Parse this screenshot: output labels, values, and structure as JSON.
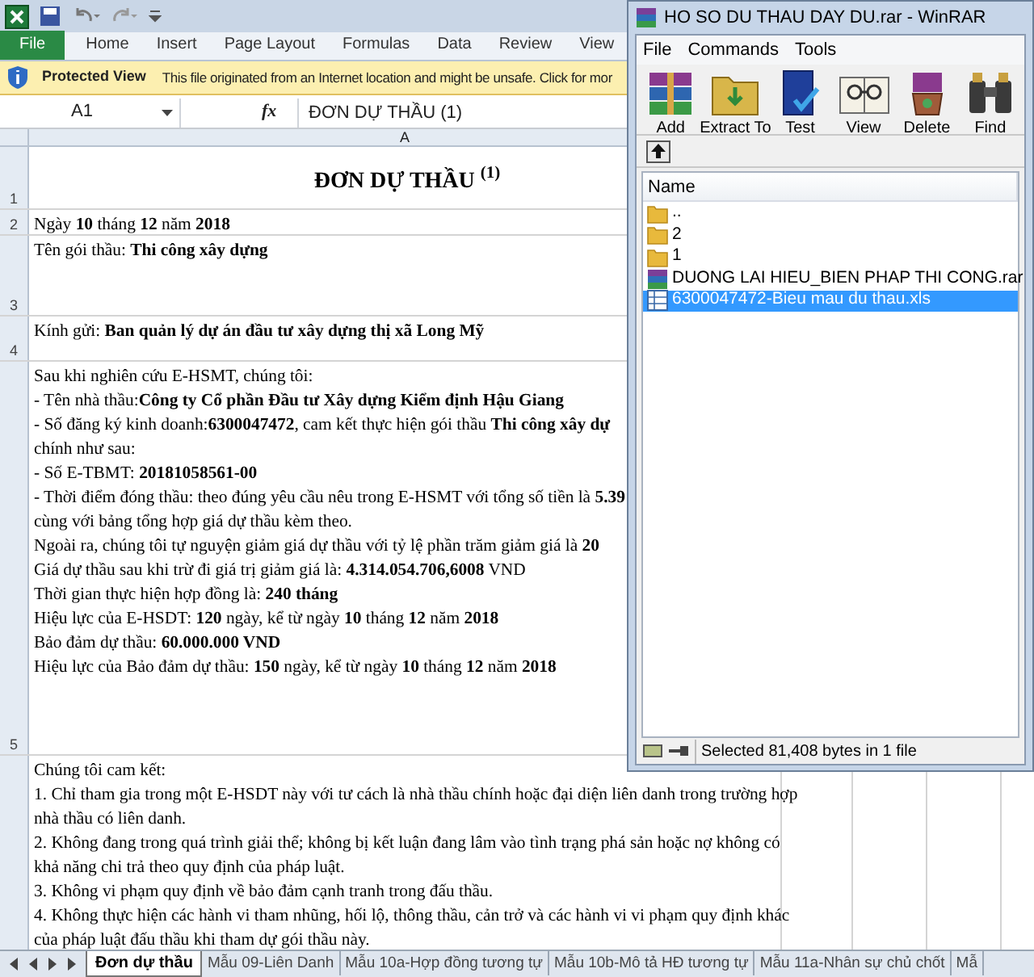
{
  "excel": {
    "ribbon_tabs": [
      {
        "label": "File",
        "selected": true
      },
      {
        "label": "Home",
        "selected": false
      },
      {
        "label": "Insert",
        "selected": false
      },
      {
        "label": "Page Layout",
        "selected": false
      },
      {
        "label": "Formulas",
        "selected": false
      },
      {
        "label": "Data",
        "selected": false
      },
      {
        "label": "Review",
        "selected": false
      },
      {
        "label": "View",
        "selected": false
      }
    ],
    "protected_view": {
      "title": "Protected View",
      "message": "This file originated from an Internet location and might be unsafe. Click for mor"
    },
    "formula_bar": {
      "cell": "A1",
      "fx_label": "fx",
      "formula": "ĐƠN DỰ THẦU (1)"
    },
    "column_header": "A",
    "rows": [
      {
        "number": "1",
        "kind": "title",
        "lines": [
          "ĐƠN DỰ THẦU $^{(1)}$"
        ]
      },
      {
        "number": "2",
        "kind": "text",
        "lines": [
          "Ngày **10** tháng **12** năm **2018**"
        ]
      },
      {
        "number": "3",
        "kind": "text",
        "lines": [
          "Tên gói thầu: **Thi công xây dựng**"
        ]
      },
      {
        "number": "4",
        "kind": "text",
        "lines": [
          "Kính gửi: **Ban quản lý dự án đầu tư xây dựng thị xã Long Mỹ**"
        ]
      },
      {
        "number": "5",
        "kind": "text",
        "lines": [
          "Sau khi nghiên cứu E-HSMT, chúng tôi:",
          "- Tên nhà thầu:**Công ty Cổ phần Đầu tư Xây dựng Kiểm định Hậu Giang**",
          "- Số đăng ký kinh doanh:**6300047472**, cam kết thực hiện gói thầu **Thi công xây dự**",
          "chính như sau:",
          "- Số E-TBMT: **20181058561-00**",
          "- Thời điểm đóng thầu: theo đúng yêu cầu nêu trong E-HSMT với tổng số tiền là **5.39**",
          "cùng với bảng tổng hợp giá dự thầu kèm theo.",
          "Ngoài ra, chúng tôi tự nguyện giảm giá dự thầu với tỷ lệ phần trăm giảm giá là **20**",
          "Giá dự thầu sau khi trừ đi giá trị giảm giá là: **4.314.054.706,6008** VND",
          "Thời gian thực hiện hợp đồng là: **240 tháng**",
          "Hiệu lực của E-HSDT: **120** ngày, kể từ ngày **10** tháng **12** năm **2018**",
          "Bảo đảm dự thầu: **60.000.000 VND**",
          "Hiệu lực của Bảo đảm dự thầu: **150** ngày, kể từ ngày **10** tháng **12** năm **2018**"
        ]
      },
      {
        "kind": "text",
        "lines": [
          "Chúng tôi cam kết:",
          "1. Chỉ tham gia trong một E-HSDT này với tư cách là nhà thầu chính hoặc đại diện liên danh trong trường hợp",
          "nhà thầu có liên danh.",
          "2. Không đang trong quá trình giải thể; không bị kết luận đang lâm vào tình trạng phá sản hoặc nợ không có",
          "khả năng chi trả theo quy định của pháp luật.",
          "3. Không vi phạm quy định về bảo đảm cạnh tranh trong đấu thầu.",
          "4. Không thực hiện các hành vi tham nhũng, hối lộ, thông thầu, cản trở và các hành vi vi phạm quy định khác",
          "của pháp luật đấu thầu khi tham dự gói thầu này."
        ]
      }
    ],
    "sheet_tabs": [
      {
        "label": "Đơn dự thầu",
        "selected": true
      },
      {
        "label": "Mẫu 09-Liên Danh",
        "selected": false
      },
      {
        "label": "Mẫu 10a-Hợp đồng tương tự",
        "selected": false
      },
      {
        "label": "Mẫu 10b-Mô tả HĐ tương tự",
        "selected": false
      },
      {
        "label": "Mẫu 11a-Nhân sự chủ chốt",
        "selected": false
      },
      {
        "label": "Mẫ",
        "selected": false
      }
    ]
  },
  "winrar": {
    "title": "HO SO DU THAU DAY DU.rar - WinRAR",
    "menu": [
      "File",
      "Commands",
      "Tools"
    ],
    "toolbar": [
      {
        "label": "Add",
        "kind": "add"
      },
      {
        "label": "Extract To",
        "kind": "extract"
      },
      {
        "label": "Test",
        "kind": "test"
      },
      {
        "label": "View",
        "kind": "view"
      },
      {
        "label": "Delete",
        "kind": "delete"
      },
      {
        "label": "Find",
        "kind": "find"
      }
    ],
    "columns": [
      "Name"
    ],
    "files": [
      {
        "name": "..",
        "kind": "folder",
        "selected": false
      },
      {
        "name": "2",
        "kind": "folder",
        "selected": false
      },
      {
        "name": "1",
        "kind": "folder",
        "selected": false
      },
      {
        "name": "DUONG LAI HIEU_BIEN PHAP THI CONG.rar",
        "kind": "archive",
        "selected": false
      },
      {
        "name": "6300047472-Bieu mau du thau.xls",
        "kind": "sheet",
        "selected": true
      }
    ],
    "status": "Selected 81,408 bytes in 1 file"
  }
}
